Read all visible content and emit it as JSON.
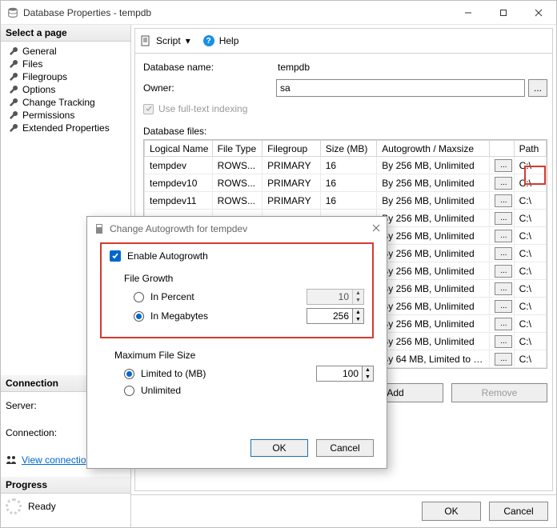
{
  "window": {
    "title": "Database Properties - tempdb"
  },
  "sidebar": {
    "select_page": "Select a page",
    "items": [
      "General",
      "Files",
      "Filegroups",
      "Options",
      "Change Tracking",
      "Permissions",
      "Extended Properties"
    ],
    "connection_hdr": "Connection",
    "server_lbl": "Server:",
    "connection_lbl": "Connection:",
    "view_conn": "View connectio",
    "progress_hdr": "Progress",
    "progress_status": "Ready"
  },
  "toolbar": {
    "script": "Script",
    "help": "Help"
  },
  "form": {
    "dbname_lbl": "Database name:",
    "dbname_val": "tempdb",
    "owner_lbl": "Owner:",
    "owner_val": "sa",
    "fulltext_lbl": "Use full-text indexing",
    "files_lbl": "Database files:"
  },
  "grid": {
    "headers": [
      "Logical Name",
      "File Type",
      "Filegroup",
      "Size (MB)",
      "Autogrowth / Maxsize",
      "",
      "Path"
    ],
    "rows": [
      {
        "name": "tempdev",
        "type": "ROWS...",
        "fg": "PRIMARY",
        "size": "16",
        "auto": "By 256 MB, Unlimited",
        "path": "C:\\"
      },
      {
        "name": "tempdev10",
        "type": "ROWS...",
        "fg": "PRIMARY",
        "size": "16",
        "auto": "By 256 MB, Unlimited",
        "path": "C:\\"
      },
      {
        "name": "tempdev11",
        "type": "ROWS...",
        "fg": "PRIMARY",
        "size": "16",
        "auto": "By 256 MB, Unlimited",
        "path": "C:\\"
      },
      {
        "name": "",
        "type": "",
        "fg": "",
        "size": "",
        "auto": "By 256 MB, Unlimited",
        "path": "C:\\"
      },
      {
        "name": "",
        "type": "",
        "fg": "",
        "size": "",
        "auto": "By 256 MB, Unlimited",
        "path": "C:\\"
      },
      {
        "name": "",
        "type": "",
        "fg": "",
        "size": "",
        "auto": "By 256 MB, Unlimited",
        "path": "C:\\"
      },
      {
        "name": "",
        "type": "",
        "fg": "",
        "size": "",
        "auto": "By 256 MB, Unlimited",
        "path": "C:\\"
      },
      {
        "name": "",
        "type": "",
        "fg": "",
        "size": "",
        "auto": "By 256 MB, Unlimited",
        "path": "C:\\"
      },
      {
        "name": "",
        "type": "",
        "fg": "",
        "size": "",
        "auto": "By 256 MB, Unlimited",
        "path": "C:\\"
      },
      {
        "name": "",
        "type": "",
        "fg": "",
        "size": "",
        "auto": "By 256 MB, Unlimited",
        "path": "C:\\"
      },
      {
        "name": "",
        "type": "",
        "fg": "",
        "size": "",
        "auto": "By 256 MB, Unlimited",
        "path": "C:\\"
      },
      {
        "name": "",
        "type": "",
        "fg": "",
        "size": "",
        "auto": "By 64 MB, Limited to 2...",
        "path": "C:\\"
      }
    ],
    "add": "Add",
    "remove": "Remove"
  },
  "footer": {
    "ok": "OK",
    "cancel": "Cancel"
  },
  "dialog": {
    "title": "Change Autogrowth for tempdev",
    "enable": "Enable Autogrowth",
    "filegrowth": "File Growth",
    "in_percent": "In Percent",
    "in_mb": "In Megabytes",
    "percent_val": "10",
    "mb_val": "256",
    "maxsize": "Maximum File Size",
    "limited": "Limited to (MB)",
    "unlimited": "Unlimited",
    "limited_val": "100",
    "ok": "OK",
    "cancel": "Cancel"
  }
}
